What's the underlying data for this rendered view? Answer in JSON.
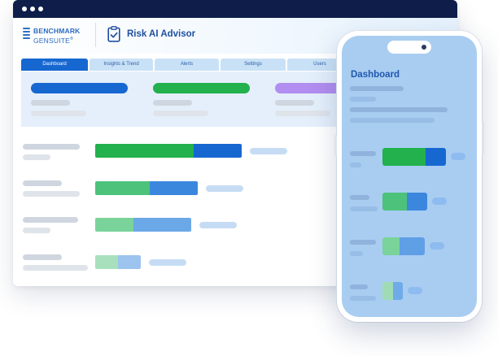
{
  "window": {
    "brand_line1": "BENCHMARK",
    "brand_line2": "GENSUITE",
    "brand_mark": "®",
    "app_title": "Risk AI Advisor",
    "tabs": [
      {
        "label": "Dashboard",
        "active": true
      },
      {
        "label": "Insights & Trend",
        "active": false
      },
      {
        "label": "Alerts",
        "active": false
      },
      {
        "label": "Settings",
        "active": false
      },
      {
        "label": "Users",
        "active": false
      }
    ],
    "summary_cards": [
      {
        "accent": "#1767d1"
      },
      {
        "accent": "#22b14c"
      },
      {
        "accent": "#b28ef0"
      }
    ],
    "rows": [
      {
        "segments": [
          {
            "share": 0.67,
            "color": "#22b14c"
          },
          {
            "share": 0.33,
            "color": "#1767d1"
          }
        ]
      },
      {
        "segments": [
          {
            "share": 0.53,
            "color": "#4cc27a"
          },
          {
            "share": 0.47,
            "color": "#3b87dd"
          }
        ]
      },
      {
        "segments": [
          {
            "share": 0.4,
            "color": "#79d39a"
          },
          {
            "share": 0.6,
            "color": "#6aa8e8"
          }
        ]
      },
      {
        "segments": [
          {
            "share": 0.5,
            "color": "#a8e0bd"
          },
          {
            "share": 0.5,
            "color": "#9cc4ef"
          }
        ]
      }
    ]
  },
  "phone": {
    "title": "Dashboard",
    "rows": [
      {
        "segments": [
          {
            "share": 0.68,
            "color": "#22b14c"
          },
          {
            "share": 0.32,
            "color": "#1767d1"
          }
        ]
      },
      {
        "segments": [
          {
            "share": 0.55,
            "color": "#4cc27a"
          },
          {
            "share": 0.45,
            "color": "#3b87dd"
          }
        ]
      },
      {
        "segments": [
          {
            "share": 0.4,
            "color": "#79d39a"
          },
          {
            "share": 0.6,
            "color": "#5f9fe6"
          }
        ]
      },
      {
        "segments": [
          {
            "share": 0.5,
            "color": "#9fdcb6"
          },
          {
            "share": 0.5,
            "color": "#6faae9"
          }
        ]
      }
    ]
  },
  "colors": {
    "titlebar": "#0e1d4a",
    "brand": "#2b6bc0",
    "phone_screen": "#a8cdf1"
  }
}
